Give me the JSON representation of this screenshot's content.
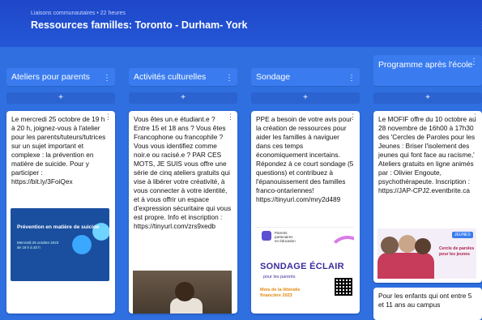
{
  "header": {
    "meta": "Liaisons communautaires • 22 heures",
    "title": "Ressources familles: Toronto - Durham- York"
  },
  "columns": [
    {
      "title": "Ateliers pour parents",
      "add": "+",
      "card": {
        "text": "Le mercredi 25 octobre de 19 h à 20 h, joignez-vous à l'atelier pour les parents/tuteurs/tutrices sur un sujet important et complexe : la prévention en matière de suicide. Pour y participer :\nhttps://bit.ly/3FoiQex",
        "image_title": "Prévention en matière de suicide",
        "image_sub": "Mercredi 25 octobre 2023\nde 19 h à 20 h"
      }
    },
    {
      "title": "Activités culturelles",
      "add": "+",
      "card": {
        "text": "Vous êtes un.e étudiant.e ? Entre 15 et 18 ans ? Vous êtes Francophone ou francophile ? Vous vous identifiez comme noir.e ou racisé.e ? PAR CES MOTS, JE SUIS vous offre une série de cinq ateliers gratuits qui vise à libérer votre créativité, à vous connecter à votre identité, et à vous offrir un espace d'expression sécuritaire qui vous est propre. Info et inscription :\nhttps://tinyurl.com/zrs9xedb"
      }
    },
    {
      "title": "Sondage",
      "add": "+",
      "card": {
        "text": "PPE a besoin de votre avis pour la création de ressources pour aider les familles à naviguer dans ces temps économiquement incertains. Répondez à ce court sondage (5 questions) et contribuez à l'épanouissement des familles franco-ontariennes!\nhttps://tinyurl.com/mry2d489",
        "logo_text": "Parents\npartenaires\nen éducation",
        "image_title": "SONDAGE ÉCLAIR",
        "image_sub": "pour les parents",
        "image_footer": "Mois de la littératie\nfinancière 2023"
      }
    },
    {
      "title": "Programme après l'école",
      "add": "+",
      "card": {
        "text": "Le MOFIF offre du 10 octobre au 28 novembre de 16h00 à 17h30 des 'Cercles de Paroles pour les Jeunes : Briser l'isolement des jeunes qui font face au racisme,' Ateliers gratuits en ligne animés par : Olivier Engoute, psychothérapeute. Inscription : https://JAP-CPJ2.eventbrite.ca",
        "badge": "JEUNES",
        "image_title": "Cercle de paroles\npour les jeunes"
      },
      "card2": {
        "text": "Pour les enfants qui ont entre 5 et 11 ans au campus"
      }
    }
  ]
}
